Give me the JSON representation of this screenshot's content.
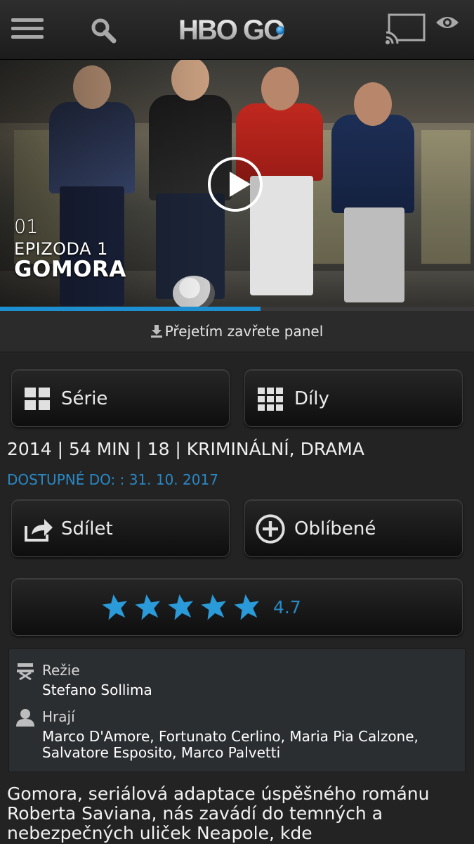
{
  "header": {
    "logo_text": "HBO GO",
    "menu_icon": "hamburger-menu-icon",
    "search_icon": "search-icon",
    "cast_icon": "cast-icon",
    "eye_icon": "eye-icon"
  },
  "hero": {
    "episode_number": "01",
    "episode_name": "EPIZODA 1",
    "series_title": "GOMORA",
    "play_icon": "play-icon",
    "progress": 0.55
  },
  "swipe_hint": "Přejetím zavřete panel",
  "buttons": {
    "serie": "Série",
    "dily": "Díly",
    "share": "Sdílet",
    "favorite": "Oblíbené"
  },
  "meta": {
    "line": "2014 | 54 MIN | 18 | KRIMINÁLNÍ, DRAMA",
    "available": "DOSTUPNÉ DO: : 31. 10. 2017"
  },
  "rating": {
    "stars": 5,
    "value": "4.7"
  },
  "credits": {
    "director_label": "Režie",
    "director": "Stefano Sollima",
    "cast_label": "Hrají",
    "cast": "Marco D'Amore, Fortunato Cerlino, Maria Pia Calzone, Salvatore Esposito, Marco Palvetti"
  },
  "synopsis": "Gomora, seriálová adaptace úspěšného románu Roberta Saviana, nás zavádí do temných a nebezpečných uliček Neapole, kde"
}
